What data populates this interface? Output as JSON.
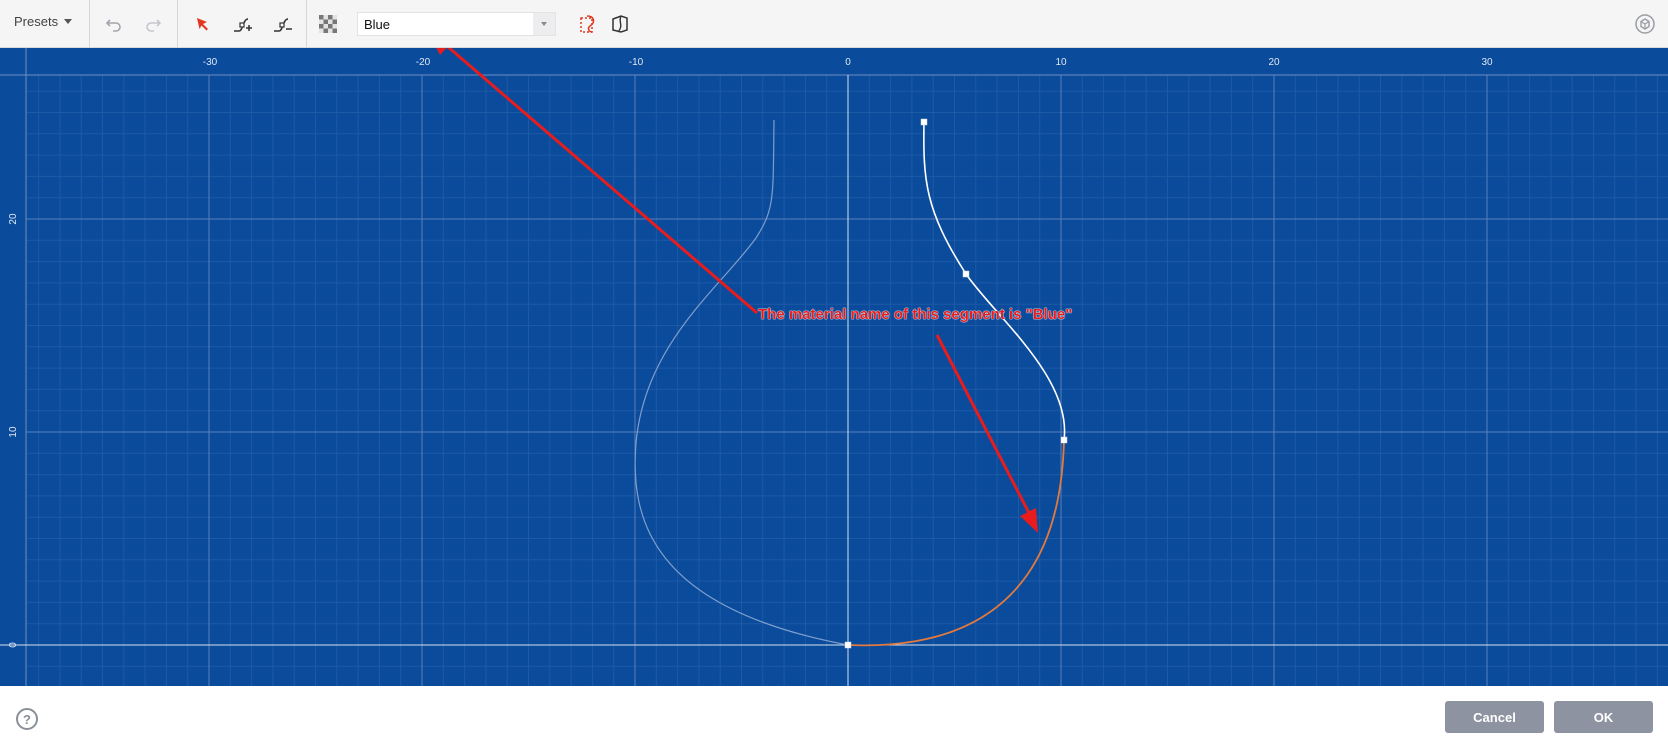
{
  "toolbar": {
    "presets_label": "Presets",
    "material": {
      "value": "Blue"
    },
    "icons": {
      "undo": "undo-icon",
      "redo": "redo-icon",
      "select": "select-arrow-icon",
      "add_point": "add-point-icon",
      "remove_point": "remove-point-icon",
      "material": "material-checker-icon",
      "view_1": "profile-view-icon",
      "view_2": "lathe-view-icon",
      "settings": "settings-icon"
    },
    "accent_color": "#e2371f"
  },
  "canvas": {
    "background_color": "#0b4b9c",
    "x_ticks": [
      "-30",
      "-20",
      "-10",
      "0",
      "10",
      "20",
      "30"
    ],
    "y_ticks": [
      "20",
      "10",
      "0"
    ],
    "profile_curve": {
      "white_segment_color": "#ffffff",
      "selected_segment_color": "#e27a3e",
      "mirror_color": "#7f9fcc"
    }
  },
  "annotation": {
    "text": "The material name of this segment is \"Blue\"",
    "color": "#e81c1c"
  },
  "footer": {
    "help_label": "?",
    "cancel_label": "Cancel",
    "ok_label": "OK"
  }
}
